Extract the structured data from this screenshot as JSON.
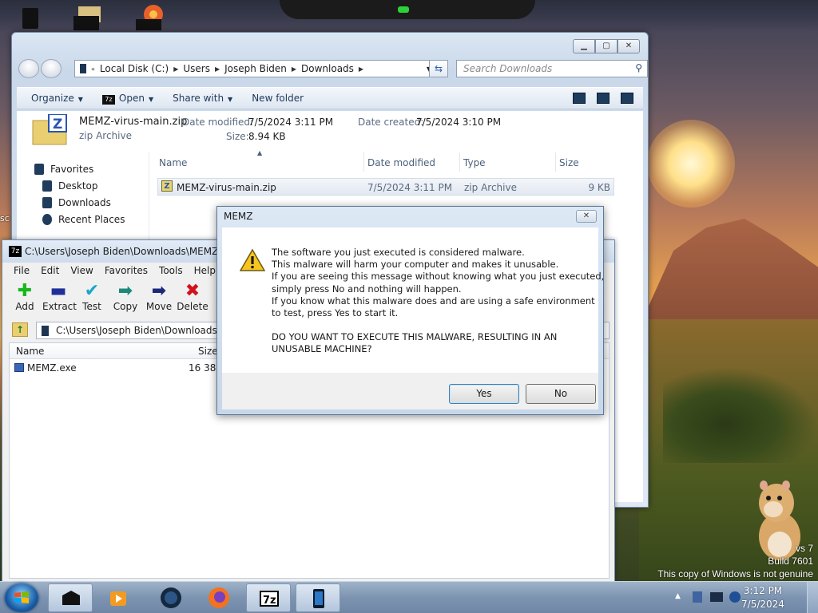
{
  "desktop": {
    "side_text": "sc",
    "watermark": {
      "line1": "vs 7",
      "line2": "Build 7601",
      "line3": "This copy of Windows is not genuine"
    }
  },
  "explorer": {
    "nav": {
      "breadcrumb": [
        "Local Disk (C:)",
        "Users",
        "Joseph Biden",
        "Downloads"
      ],
      "search_placeholder": "Search Downloads"
    },
    "commands": [
      {
        "label": "Organize",
        "dropdown": true
      },
      {
        "label": "Open",
        "dropdown": true,
        "icon": "7z-icon"
      },
      {
        "label": "Share with",
        "dropdown": true
      },
      {
        "label": "New folder",
        "dropdown": false
      }
    ],
    "details": {
      "name": "MEMZ-virus-main.zip",
      "type": "zip Archive",
      "date_modified_label": "Date modified:",
      "date_modified": "7/5/2024 3:11 PM",
      "size_label": "Size:",
      "size": "8.94 KB",
      "date_created_label": "Date created:",
      "date_created": "7/5/2024 3:10 PM"
    },
    "sidebar": [
      {
        "label": "Favorites",
        "icon": "star-icon"
      },
      {
        "label": "Desktop",
        "icon": "desktop-icon"
      },
      {
        "label": "Downloads",
        "icon": "downloads-icon"
      },
      {
        "label": "Recent Places",
        "icon": "recent-places-icon"
      }
    ],
    "columns": [
      "Name",
      "Date modified",
      "Type",
      "Size"
    ],
    "files": [
      {
        "name": "MEMZ-virus-main.zip",
        "modified": "7/5/2024 3:11 PM",
        "type": "zip Archive",
        "size": "9 KB"
      }
    ]
  },
  "sevenzip": {
    "title": "C:\\Users\\Joseph Biden\\Downloads\\MEMZ-vir",
    "menu": [
      "File",
      "Edit",
      "View",
      "Favorites",
      "Tools",
      "Help"
    ],
    "tools": [
      {
        "label": "Add",
        "icon": "add-icon",
        "color": "#18b81c"
      },
      {
        "label": "Extract",
        "icon": "extract-icon",
        "color": "#1f2f9a"
      },
      {
        "label": "Test",
        "icon": "test-icon",
        "color": "#1aa7c7"
      },
      {
        "label": "Copy",
        "icon": "copy-icon",
        "color": "#1b8a7a"
      },
      {
        "label": "Move",
        "icon": "move-icon",
        "color": "#1b2a78"
      },
      {
        "label": "Delete",
        "icon": "delete-icon",
        "color": "#d2111a"
      }
    ],
    "path": "C:\\Users\\Joseph Biden\\Downloads\\ME",
    "columns": [
      "Name",
      "Size"
    ],
    "files": [
      {
        "name": "MEMZ.exe",
        "size": "16 384"
      }
    ]
  },
  "dialog": {
    "title": "MEMZ",
    "lines": [
      "The software you just executed is considered malware.",
      "This malware will harm your computer and makes it unusable.",
      "If you are seeing this message without knowing what you just executed,",
      "simply press No and nothing will happen.",
      "If you know what this malware does and are using a safe environment",
      "to test, press Yes to start it."
    ],
    "question": [
      "DO YOU WANT TO EXECUTE THIS MALWARE, RESULTING IN AN",
      "UNUSABLE MACHINE?"
    ],
    "yes": "Yes",
    "no": "No"
  },
  "taskbar": {
    "items": [
      "app-icon",
      "media-player-icon",
      "globe-icon",
      "firefox-icon",
      "7zip-icon",
      "device-icon"
    ],
    "clock_time": "3:12 PM",
    "clock_date": "7/5/2024"
  }
}
